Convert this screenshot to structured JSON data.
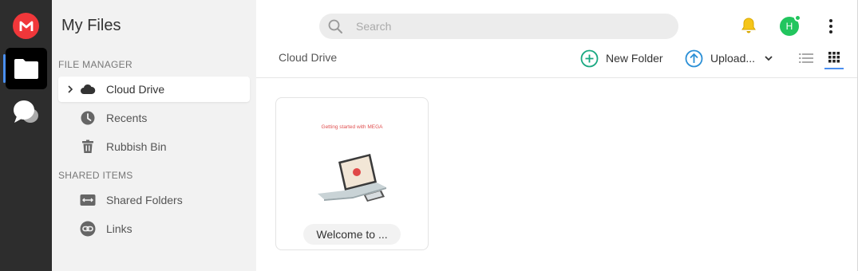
{
  "rail": {
    "logo_letter": "M",
    "items": [
      "files-icon",
      "chat-icon"
    ]
  },
  "sidebar": {
    "title": "My Files",
    "file_manager_label": "FILE MANAGER",
    "shared_items_label": "SHARED ITEMS",
    "items": [
      {
        "label": "Cloud Drive",
        "icon": "cloud-icon",
        "active": true
      },
      {
        "label": "Recents",
        "icon": "clock-icon"
      },
      {
        "label": "Rubbish Bin",
        "icon": "trash-icon"
      },
      {
        "label": "Shared Folders",
        "icon": "shared-folder-icon"
      },
      {
        "label": "Links",
        "icon": "link-icon"
      }
    ]
  },
  "header": {
    "search_placeholder": "Search",
    "avatar_letter": "H",
    "breadcrumb": "Cloud Drive",
    "new_folder_label": "New Folder",
    "upload_label": "Upload..."
  },
  "files": [
    {
      "name": "Welcome to ...",
      "thumb_caption": "Getting started with MEGA"
    }
  ],
  "colors": {
    "brand": "#f0373a",
    "accent": "#4a8ff0",
    "green": "#22c55e",
    "teal": "#1aa881",
    "bell": "#f5c518"
  }
}
